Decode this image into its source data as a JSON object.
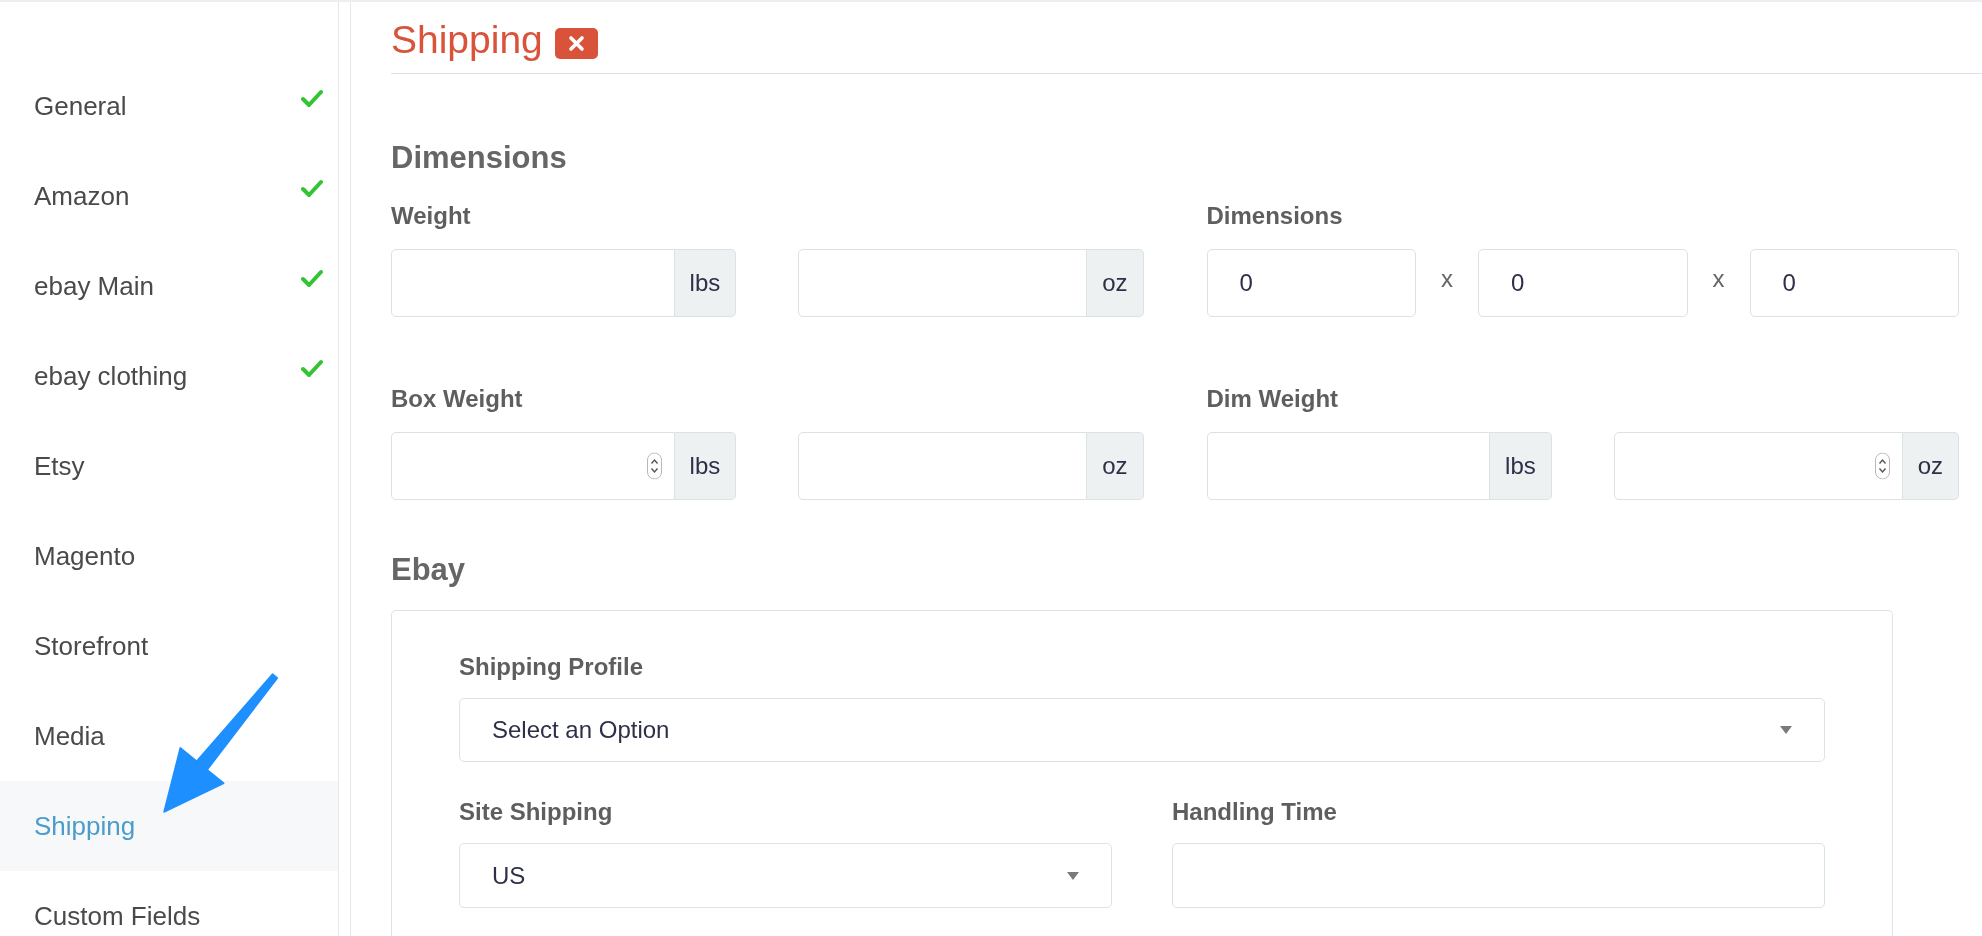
{
  "sidebar": {
    "items": [
      {
        "label": "General",
        "checked": true,
        "selected": false
      },
      {
        "label": "Amazon",
        "checked": true,
        "selected": false
      },
      {
        "label": "ebay Main",
        "checked": true,
        "selected": false
      },
      {
        "label": "ebay clothing",
        "checked": true,
        "selected": false
      },
      {
        "label": "Etsy",
        "checked": false,
        "selected": false
      },
      {
        "label": "Magento",
        "checked": false,
        "selected": false
      },
      {
        "label": "Storefront",
        "checked": false,
        "selected": false
      },
      {
        "label": "Media",
        "checked": false,
        "selected": false
      },
      {
        "label": "Shipping",
        "checked": false,
        "selected": true
      },
      {
        "label": "Custom Fields",
        "checked": false,
        "selected": false
      }
    ]
  },
  "header": {
    "title": "Shipping"
  },
  "dimensions": {
    "heading": "Dimensions",
    "rows": [
      [
        {
          "kind": "units",
          "label": "Weight",
          "inputs": [
            {
              "unit": "lbs",
              "spinner": false
            },
            {
              "unit": "oz",
              "spinner": false
            }
          ]
        },
        {
          "kind": "dimensions",
          "label": "Dimensions",
          "inputs": [
            {
              "value": "0"
            },
            {
              "separator": "x",
              "value": "0"
            },
            {
              "separator": "x",
              "value": "0"
            }
          ]
        }
      ],
      [
        {
          "kind": "units",
          "label": "Box Weight",
          "inputs": [
            {
              "unit": "lbs",
              "spinner": true
            },
            {
              "unit": "oz",
              "spinner": false
            }
          ]
        },
        {
          "kind": "units",
          "label": "Dim Weight",
          "inputs": [
            {
              "unit": "lbs",
              "spinner": false
            },
            {
              "unit": "oz",
              "spinner": true
            }
          ]
        }
      ]
    ]
  },
  "ebay": {
    "heading": "Ebay",
    "rows": [
      [
        {
          "kind": "select",
          "label": "Shipping Profile",
          "value": "Select an Option"
        }
      ],
      [
        {
          "kind": "select",
          "label": "Site Shipping",
          "value": "US"
        },
        {
          "kind": "text",
          "label": "Handling Time"
        }
      ]
    ]
  }
}
